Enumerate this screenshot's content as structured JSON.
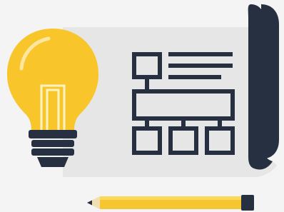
{
  "illustration": {
    "subject": "lightbulb-with-flowchart-blueprint",
    "icons": [
      "lightbulb-icon",
      "flowchart-icon",
      "pencil-icon",
      "blueprint-roll-icon"
    ],
    "colors": {
      "background": "#f4f4f4",
      "paper": "#e6e6e6",
      "navy": "#263040",
      "bulb_glass": "#f8c52a",
      "bulb_highlight": "#fde7a0",
      "filament": "#fff3c4",
      "pencil_body": "#f5c631",
      "pencil_wood": "#f1dfb2"
    }
  }
}
